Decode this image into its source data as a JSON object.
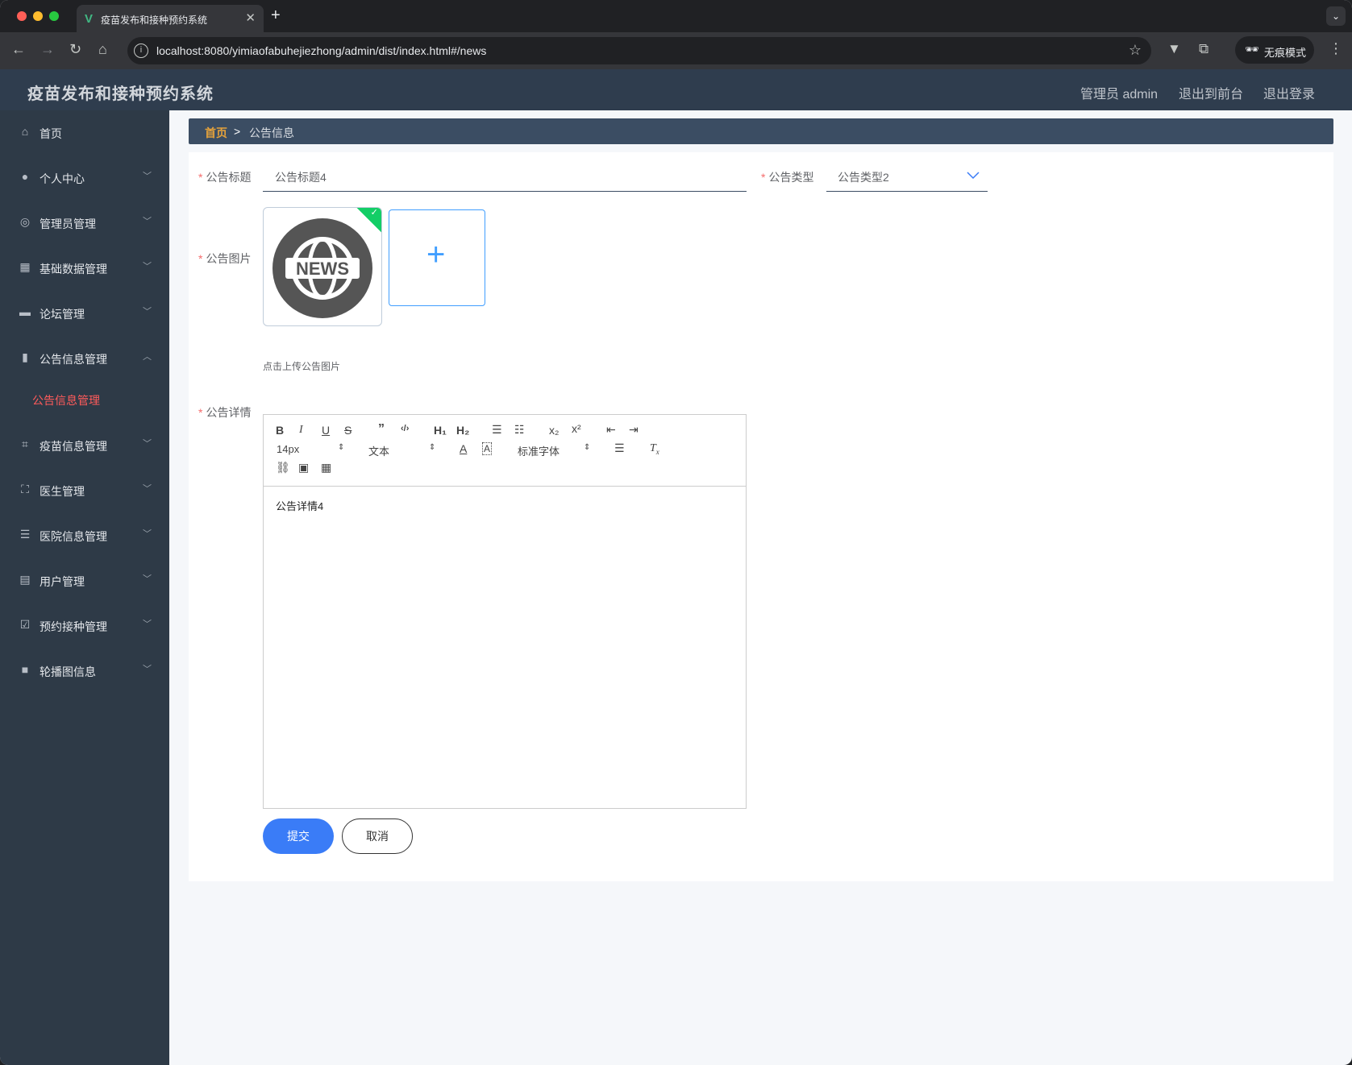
{
  "browser": {
    "tab_title": "疫苗发布和接种预约系统",
    "url": "localhost:8080/yimiaofabuhejiezhong/admin/dist/index.html#/news",
    "incognito_label": "无痕模式"
  },
  "header": {
    "app_title": "疫苗发布和接种预约系统",
    "links": [
      "管理员 admin",
      "退出到前台",
      "退出登录"
    ]
  },
  "sidebar": {
    "items": [
      {
        "label": "首页",
        "icon": "home-icon"
      },
      {
        "label": "个人中心",
        "icon": "user-icon"
      },
      {
        "label": "管理员管理",
        "icon": "compass-icon"
      },
      {
        "label": "基础数据管理",
        "icon": "grid-icon"
      },
      {
        "label": "论坛管理",
        "icon": "chat-icon"
      },
      {
        "label": "公告信息管理",
        "icon": "bar-chart-icon"
      },
      {
        "label": "疫苗信息管理",
        "icon": "crop-icon"
      },
      {
        "label": "医生管理",
        "icon": "full-screen-icon"
      },
      {
        "label": "医院信息管理",
        "icon": "sliders-icon"
      },
      {
        "label": "用户管理",
        "icon": "briefcase-icon"
      },
      {
        "label": "预约接种管理",
        "icon": "checklist-icon"
      },
      {
        "label": "轮播图信息",
        "icon": "camera-icon"
      }
    ],
    "active_sub": "公告信息管理"
  },
  "breadcrumb": {
    "home": "首页",
    "separator": ">",
    "current": "公告信息"
  },
  "form": {
    "title_label": "公告标题",
    "title_value": "公告标题4",
    "type_label": "公告类型",
    "type_value": "公告类型2",
    "image_label": "公告图片",
    "image_text": "NEWS",
    "upload_tip": "点击上传公告图片",
    "detail_label": "公告详情",
    "detail_content": "公告详情4",
    "submit": "提交",
    "cancel": "取消"
  },
  "editor": {
    "font_size": "14px",
    "header_select": "文本",
    "font_family": "标准字体"
  },
  "colors": {
    "accent": "#3a7cf7",
    "sidebar_bg": "#2e3a47",
    "header_bg": "#2f3d4e",
    "active_menu": "#ff5b5b"
  }
}
